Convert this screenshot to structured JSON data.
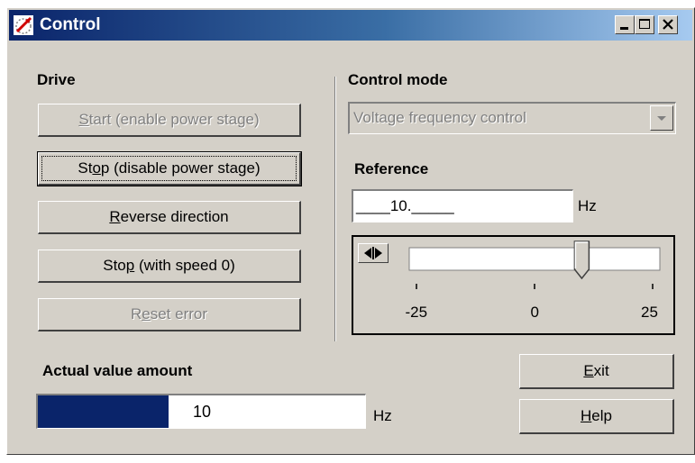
{
  "window": {
    "title": "Control"
  },
  "drive": {
    "label": "Drive",
    "start_pre": "",
    "start_key": "S",
    "start_post": "tart (enable power stage)",
    "stop_disable_pre": "St",
    "stop_disable_key": "o",
    "stop_disable_post": "p (disable power stage)",
    "reverse_pre": "",
    "reverse_key": "R",
    "reverse_post": "everse direction",
    "stop_speed_pre": "Sto",
    "stop_speed_key": "p",
    "stop_speed_post": " (with speed 0)",
    "reset_pre": "R",
    "reset_key": "e",
    "reset_post": "set error"
  },
  "control_mode": {
    "label": "Control mode",
    "selected": "Voltage frequency control"
  },
  "reference": {
    "label": "Reference",
    "value": "____10._____",
    "unit": "Hz",
    "slider": {
      "min": -25,
      "max": 25,
      "value": 10,
      "tick_min": "-25",
      "tick_mid": "0",
      "tick_max": "25"
    }
  },
  "actual": {
    "label": "Actual value amount",
    "value": "10",
    "unit": "Hz",
    "bar_fraction": 0.4
  },
  "buttons": {
    "exit_key": "E",
    "exit_post": "xit",
    "help_key": "H",
    "help_post": "elp"
  }
}
